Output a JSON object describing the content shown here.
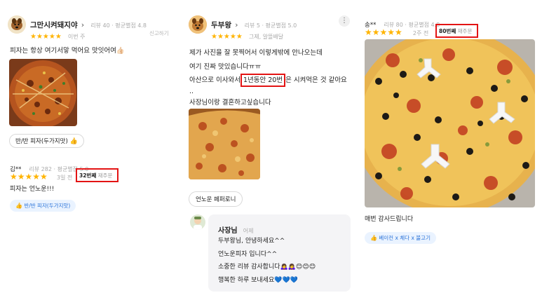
{
  "col1": {
    "review1": {
      "name": "그만시켜돼지야",
      "meta": "리뷰 40 · 평균별점 4.8",
      "stars": "★★★★★",
      "rating": 5,
      "time": "이번 주",
      "report": "신고하기",
      "text": "피자는 항상 여기서맣 먹어요 맛잇어여👍🏻",
      "menu_chip": "반/반 피자(두가지맛)"
    },
    "review2": {
      "name": "김**",
      "meta": "리뷰 282 · 평균별점 5.0",
      "stars": "★★★★★",
      "rating": 5,
      "time": "3일 전",
      "reorder_num": "32번째",
      "reorder_suffix": "재주문",
      "text": "피자는 언노운!!!",
      "tag": "반/반 피자(두가지맛)"
    }
  },
  "col2": {
    "name": "두부왕",
    "meta": "리뷰 5 · 평균별점 5.0",
    "stars": "★★★★★",
    "rating": 5,
    "time": "그제, 알뜰배달",
    "text_line1": "제가 사진을 잘 못찍어서 이렇게밖에 안나오는데",
    "text_line2": "여기 진짜 맛있습니다ㅠㅠ",
    "text_line3_pre": "아산으로 이사와서",
    "text_line3_highlight": "1년동안 20번",
    "text_line3_post": "은 시켜먹은 것 같아요",
    "text_line4": "..",
    "text_line5": "사장님이랑 결혼하고싶습니다",
    "menu_chip": "언노운 페퍼로니",
    "owner": {
      "name": "사장님",
      "time": "어제",
      "line1": "두부왕님, 안녕하세요^^",
      "line2": "언노운피자 입니다^^",
      "line3": "소중한 리뷰 감사합니다🙇‍♀️🙇‍♀️😊😊😊",
      "line4": "행복한 하루 보내세요💙💙💙"
    }
  },
  "col3": {
    "name": "송**",
    "meta": "리뷰 80 · 평균별점 4.8",
    "stars": "★★★★★",
    "rating": 5,
    "time": "2주 전",
    "reorder_num": "80번째",
    "reorder_suffix": "재주문",
    "text": "매번 감사드립니다",
    "tag": "베이컨 x 체다 x 불고기"
  },
  "icons": {
    "more": "⋮",
    "chevron": "›",
    "thumb": "👍"
  },
  "colors": {
    "star": "#ffb400",
    "highlight_box": "#e31414",
    "tag_bg": "#eaf3ff",
    "tag_text": "#2a73d8"
  }
}
